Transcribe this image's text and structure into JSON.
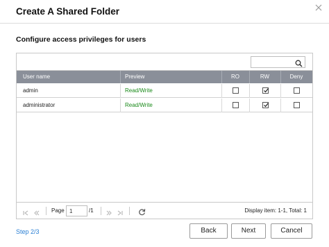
{
  "dialog": {
    "title": "Create A Shared Folder",
    "subtitle": "Configure access privileges for users"
  },
  "search": {
    "value": "",
    "placeholder": ""
  },
  "table": {
    "columns": [
      "User name",
      "Preview",
      "RO",
      "RW",
      "Deny"
    ],
    "rows": [
      {
        "user": "admin",
        "preview": "Read/Write",
        "ro": false,
        "rw": true,
        "deny": false
      },
      {
        "user": "administrator",
        "preview": "Read/Write",
        "ro": false,
        "rw": true,
        "deny": false
      }
    ]
  },
  "pager": {
    "page_label": "Page",
    "page_value": "1",
    "total_pages": "/1",
    "display_info": "Display item: 1-1, Total: 1"
  },
  "footer": {
    "step": "Step 2/3",
    "back_label": "Back",
    "next_label": "Next",
    "cancel_label": "Cancel"
  },
  "colors": {
    "header_bg": "#8a8f99",
    "preview_text": "#1a8a1a",
    "link": "#2a7fd4"
  }
}
